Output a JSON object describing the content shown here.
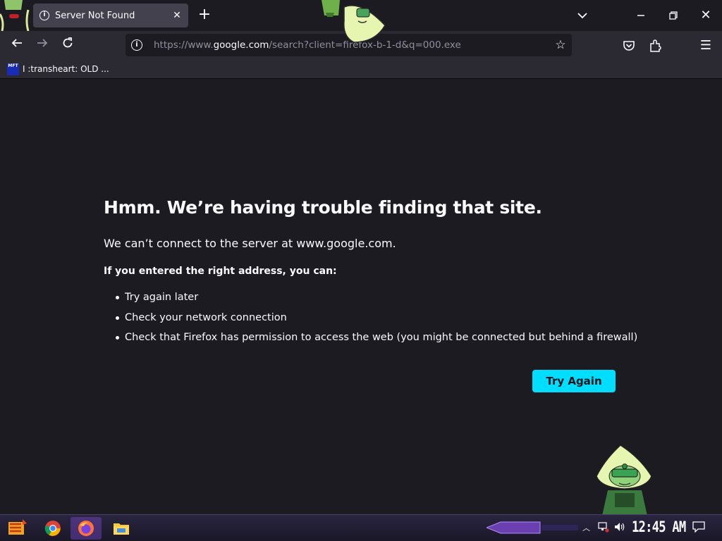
{
  "browser": {
    "tab": {
      "title": "Server Not Found"
    },
    "url": {
      "prefix": "https://www.",
      "host": "google.com",
      "path": "/search?client=firefox-b-1-d&q=000.exe"
    },
    "bookmarks": [
      {
        "label": "I :transheart: OLD ...",
        "favicon_text": "MFT"
      }
    ]
  },
  "error_page": {
    "title": "Hmm. We’re having trouble finding that site.",
    "description": "We can’t connect to the server at www.google.com.",
    "subheading": "If you entered the right address, you can:",
    "suggestions": [
      "Try again later",
      "Check your network connection",
      "Check that Firefox has permission to access the web (you might be connected but behind a firewall)"
    ],
    "button_label": "Try Again"
  },
  "taskbar": {
    "clock": "12:45 AM",
    "apps": [
      "chrome-icon",
      "firefox-icon",
      "file-explorer-icon"
    ]
  },
  "colors": {
    "accent_button": "#00ddff",
    "page_background": "#1c1b22",
    "toolbar": "#2b2a33"
  }
}
